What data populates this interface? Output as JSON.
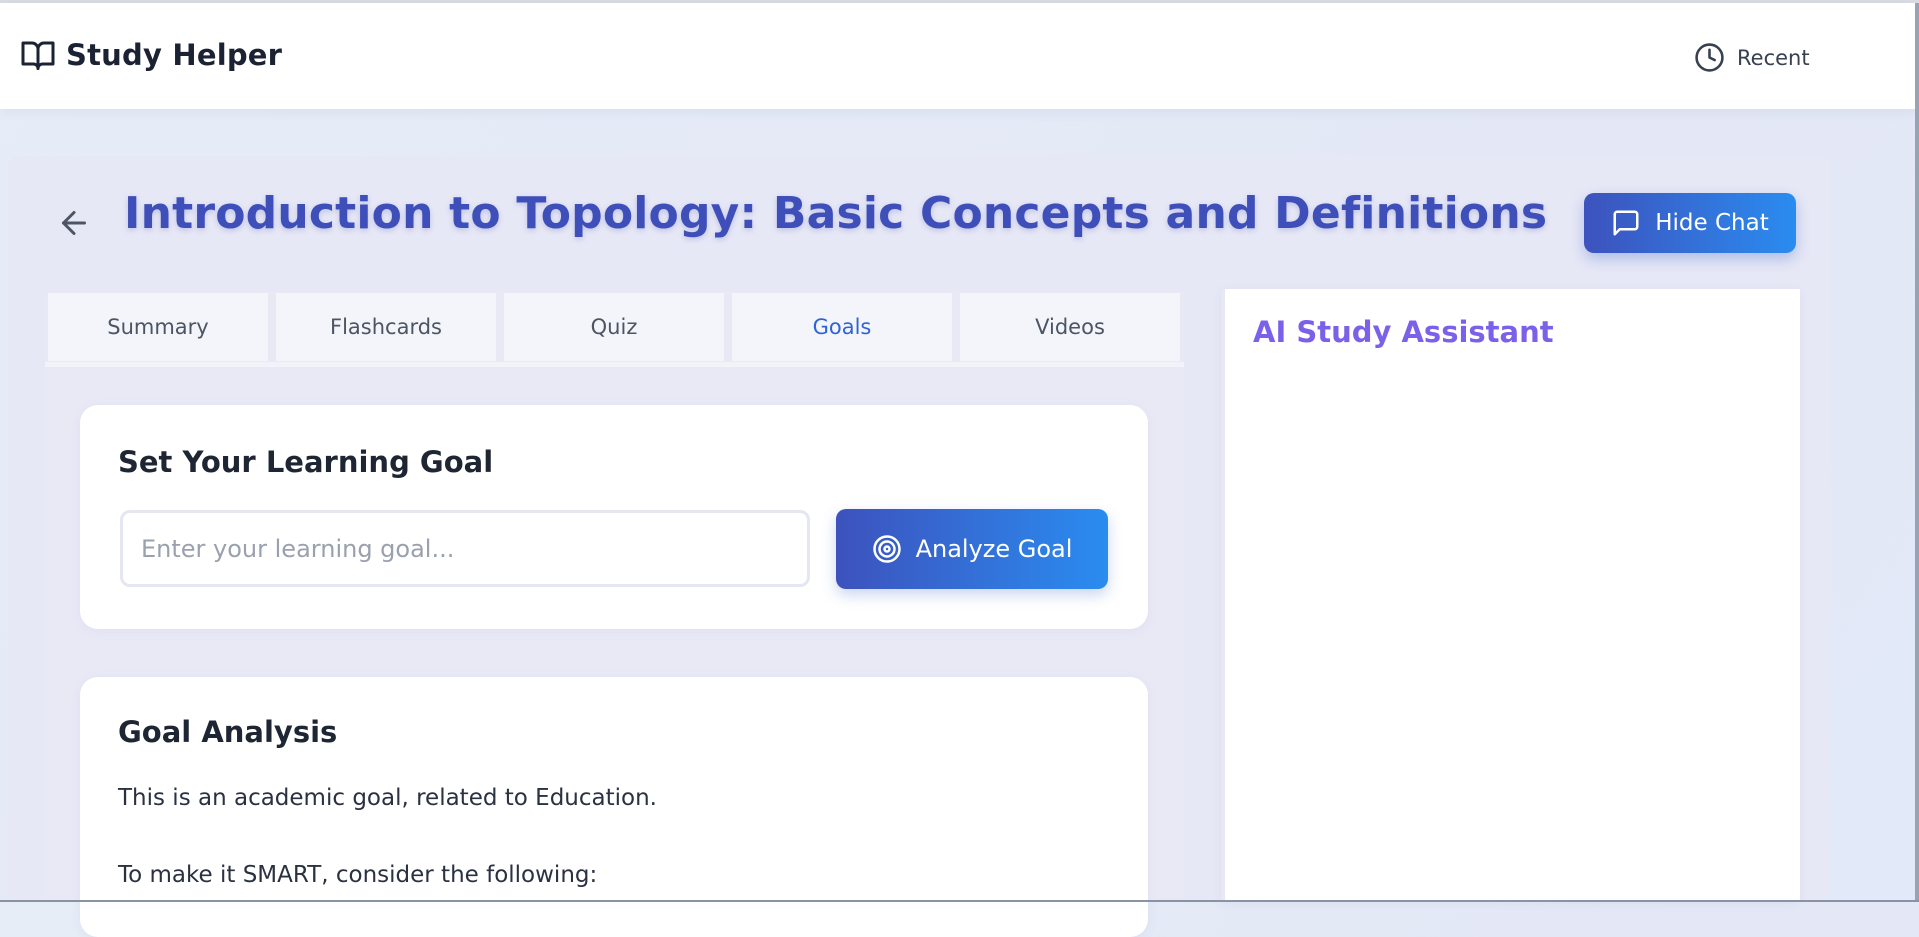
{
  "header": {
    "app_name": "Study Helper",
    "brand_icon": "book-open-icon",
    "recent_label": "Recent",
    "recent_icon": "clock-icon"
  },
  "page": {
    "title": "Introduction to Topology: Basic Concepts and Definitions",
    "back_icon": "arrow-left-icon",
    "hide_chat_label": "Hide Chat",
    "hide_chat_icon": "message-square-icon"
  },
  "tabs": [
    {
      "label": "Summary",
      "active": false
    },
    {
      "label": "Flashcards",
      "active": false
    },
    {
      "label": "Quiz",
      "active": false
    },
    {
      "label": "Goals",
      "active": true
    },
    {
      "label": "Videos",
      "active": false
    }
  ],
  "goal_card": {
    "title": "Set Your Learning Goal",
    "input_value": "",
    "input_placeholder": "Enter your learning goal...",
    "button_label": "Analyze Goal",
    "button_icon": "target-icon"
  },
  "analysis_card": {
    "title": "Goal Analysis",
    "line1": "This is an academic goal, related to Education.",
    "line2": "To make it SMART, consider the following:"
  },
  "chat": {
    "title": "AI Study Assistant"
  },
  "colors": {
    "accent": "#3f4fb9",
    "button_gradient_start": "#3d52bd",
    "button_gradient_end": "#2a8cf0",
    "active_tab": "#2f63d9",
    "chat_title": "#7b61ea"
  }
}
